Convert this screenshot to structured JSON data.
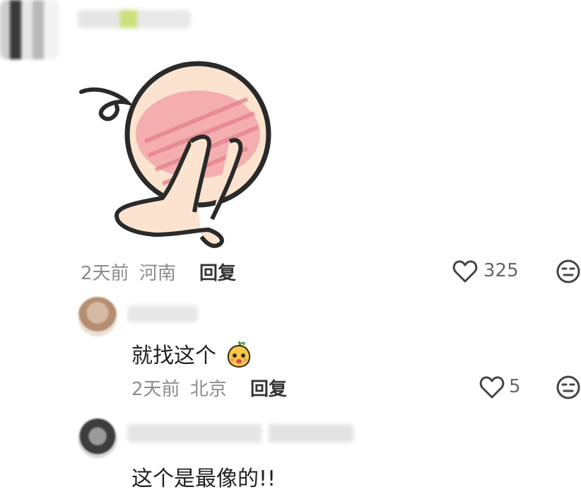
{
  "comment": {
    "meta": {
      "time": "2天前",
      "location": "河南"
    },
    "reply_label": "回复",
    "like_count": "325"
  },
  "replies": [
    {
      "text": "就找这个",
      "emoji": "pear-face-emoji",
      "meta": {
        "time": "2天前",
        "location": "北京"
      },
      "reply_label": "回复",
      "like_count": "5"
    },
    {
      "text": "这个是最像的!!"
    }
  ],
  "icons": {
    "like": "heart-outline-icon",
    "dislike": "meh-face-icon"
  },
  "colors": {
    "meta_text": "#8c8c8c",
    "reply_text": "#333333",
    "icon_stroke": "#444444"
  }
}
